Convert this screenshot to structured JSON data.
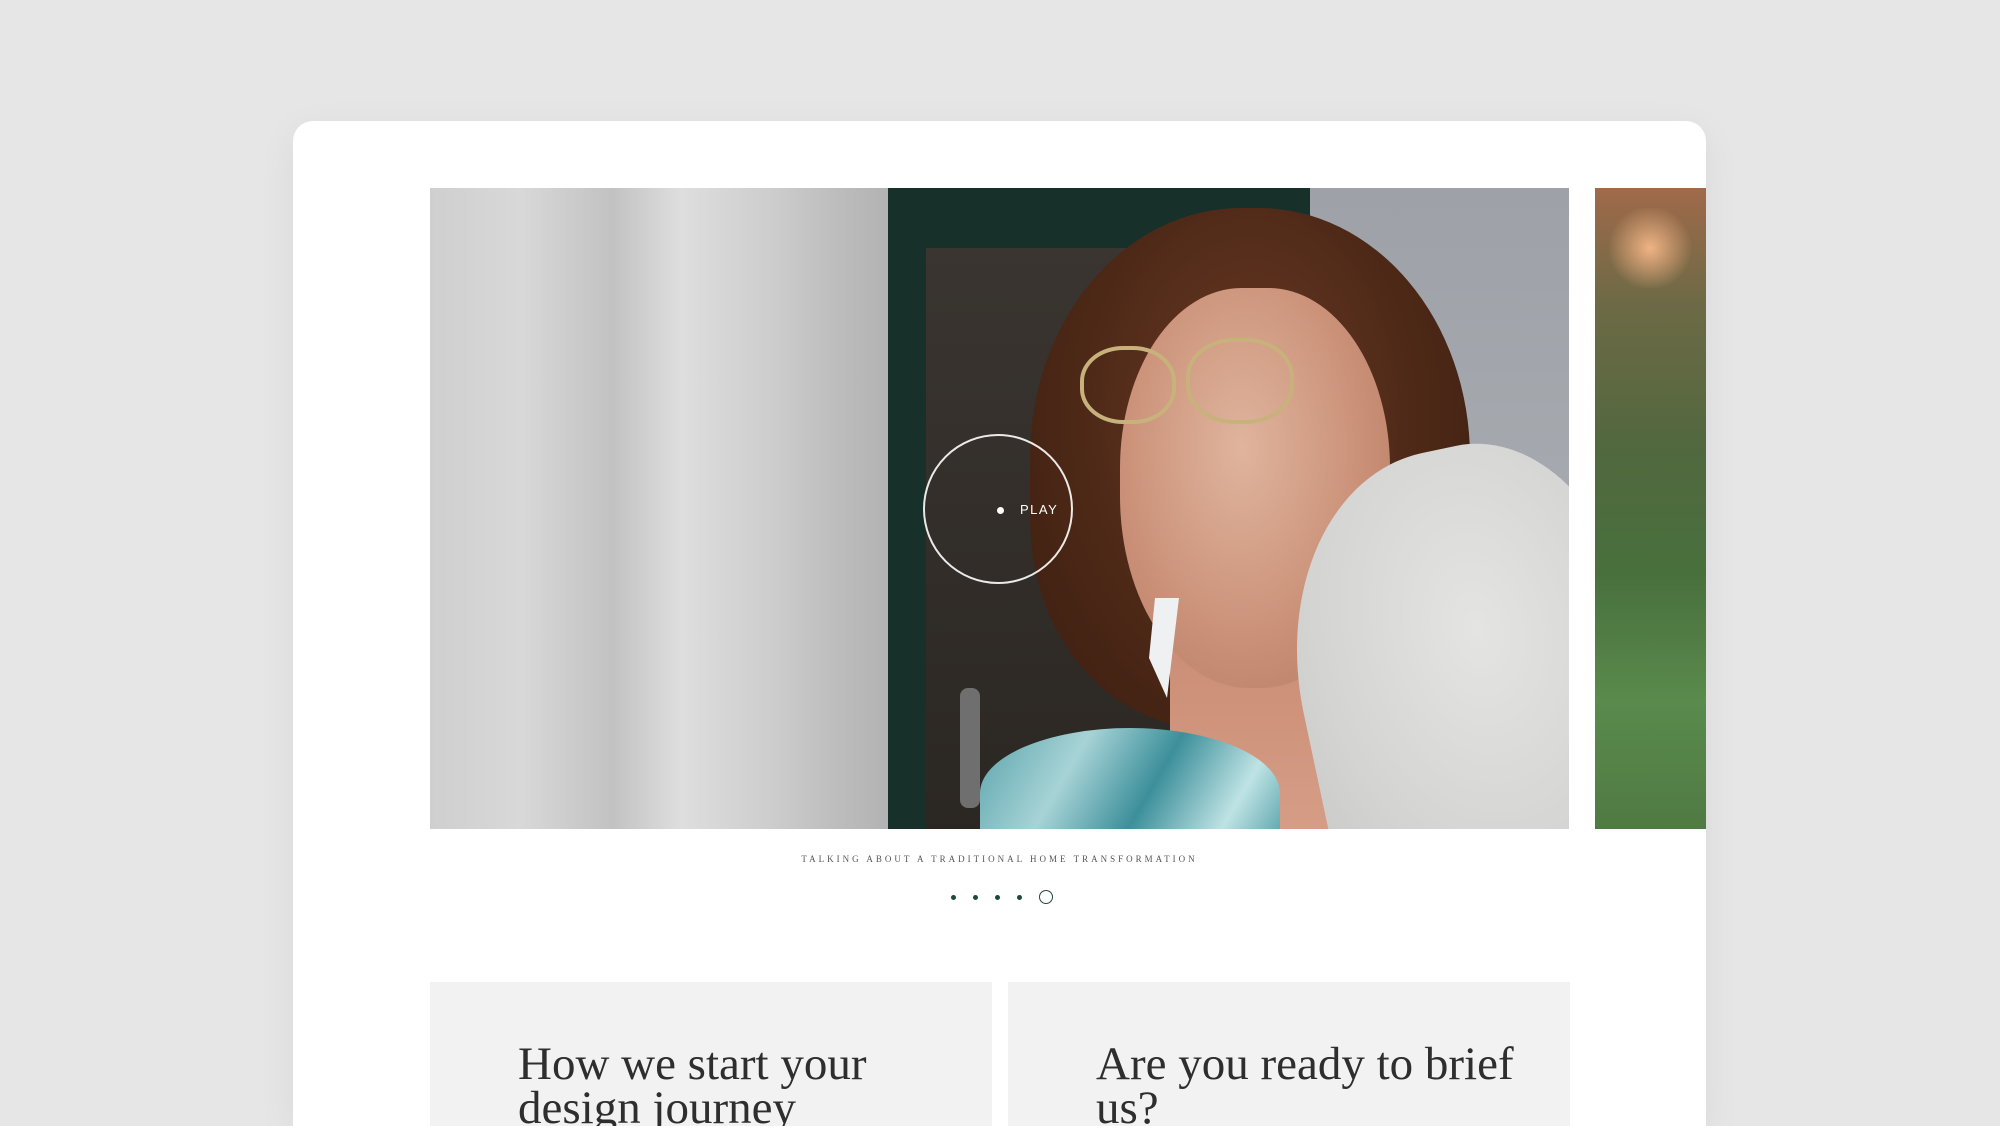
{
  "video": {
    "play_label": "PLAY",
    "caption": "Talking about a traditional home transformation"
  },
  "carousel": {
    "dot_count": 5,
    "active_index": 4,
    "accent_color": "#1e4a3d"
  },
  "panels": [
    {
      "title": "How we start your design journey"
    },
    {
      "title": "Are you ready to brief us?"
    }
  ]
}
